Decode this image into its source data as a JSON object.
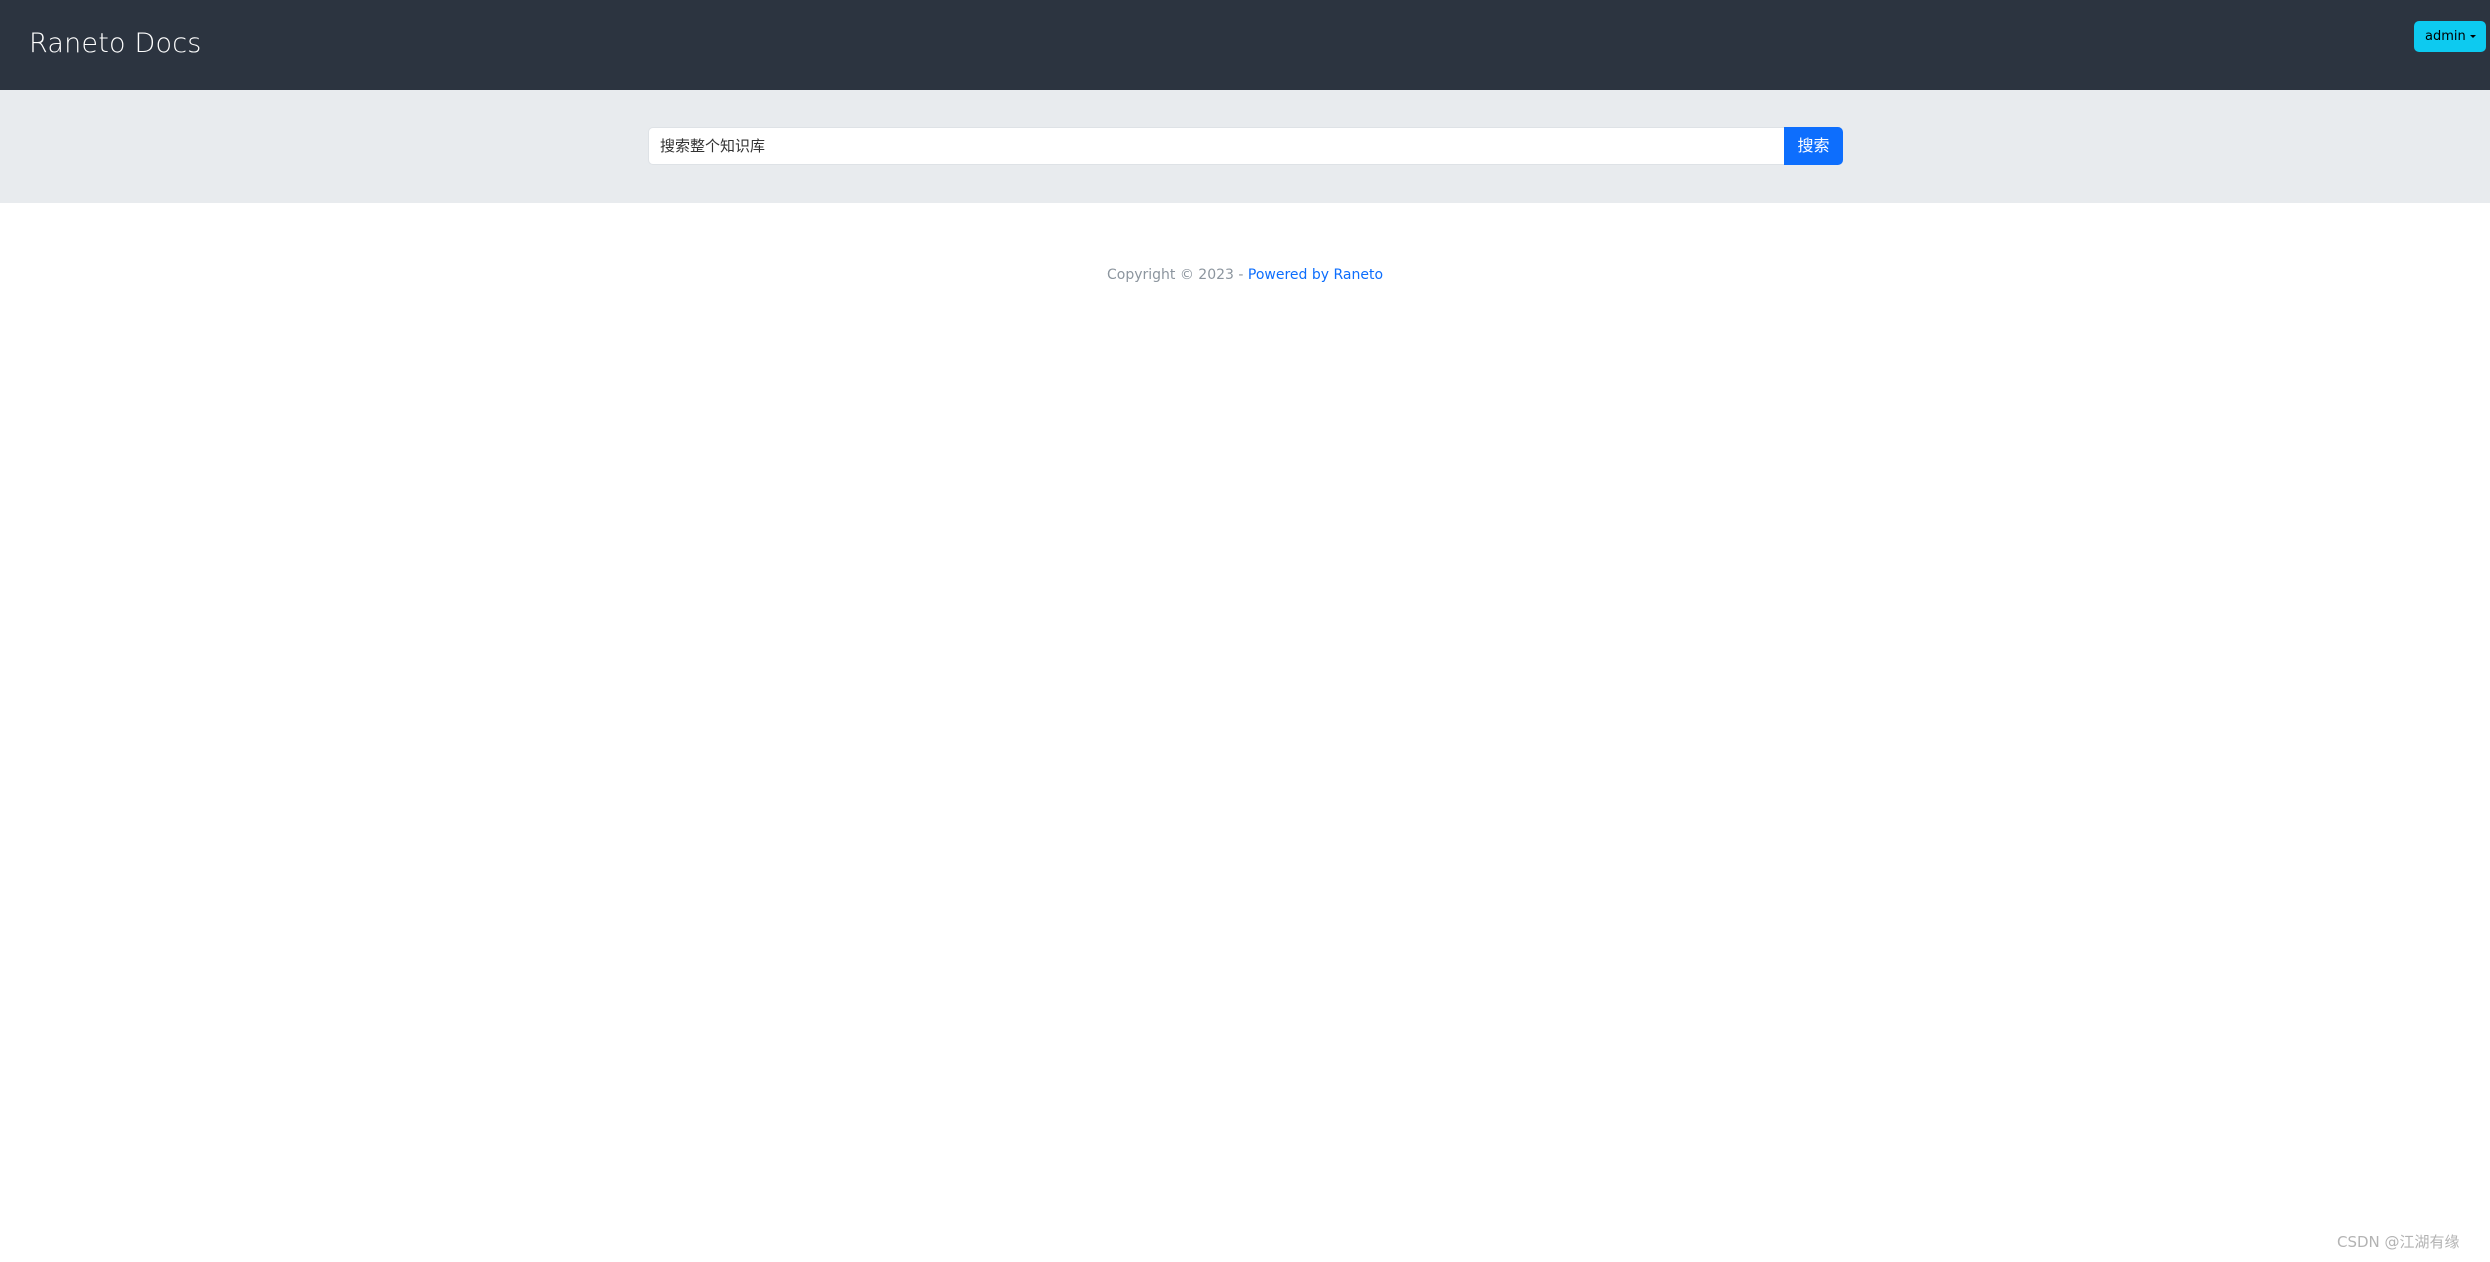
{
  "navbar": {
    "brand": "Raneto Docs",
    "user_menu_label": "admin"
  },
  "search": {
    "placeholder": "搜索整个知识库",
    "button_label": "搜索"
  },
  "footer": {
    "copyright": "Copyright © 2023 - ",
    "powered_by": "Powered by Raneto"
  },
  "watermark": "CSDN @江湖有缘",
  "colors": {
    "navbar_bg": "#2c3440",
    "search_band_bg": "#e8ebee",
    "primary": "#0d6efd",
    "info": "#0dcaf0"
  },
  "icons": {
    "user_menu": "chevron-down-icon"
  }
}
